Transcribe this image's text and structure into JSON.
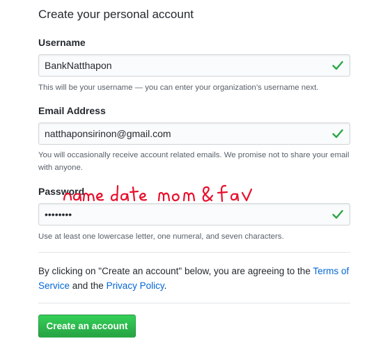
{
  "form": {
    "title": "Create your personal account",
    "username": {
      "label": "Username",
      "value": "BankNatthapon",
      "hint": "This will be your username — you can enter your organization’s username next."
    },
    "email": {
      "label": "Email Address",
      "value": "natthaponsirinon@gmail.com",
      "hint": "You will occasionally receive account related emails. We promise not to share your email with anyone."
    },
    "password": {
      "label": "Password",
      "value": "fakepass",
      "hint": "Use at least one lowercase letter, one numeral, and seven characters."
    },
    "annotation": "name date mom & fav",
    "terms": {
      "prefix": "By clicking on \"Create an account\" below, you are agreeing to the ",
      "terms_link": "Terms of Service",
      "middle": " and the ",
      "privacy_link": "Privacy Policy",
      "suffix": "."
    },
    "submit_label": "Create an account"
  },
  "colors": {
    "valid_check": "#28a745",
    "link": "#0366d6",
    "button": "#2ea44f",
    "annotation_ink": "#e8112d"
  },
  "icons": {
    "valid": "check-icon"
  }
}
